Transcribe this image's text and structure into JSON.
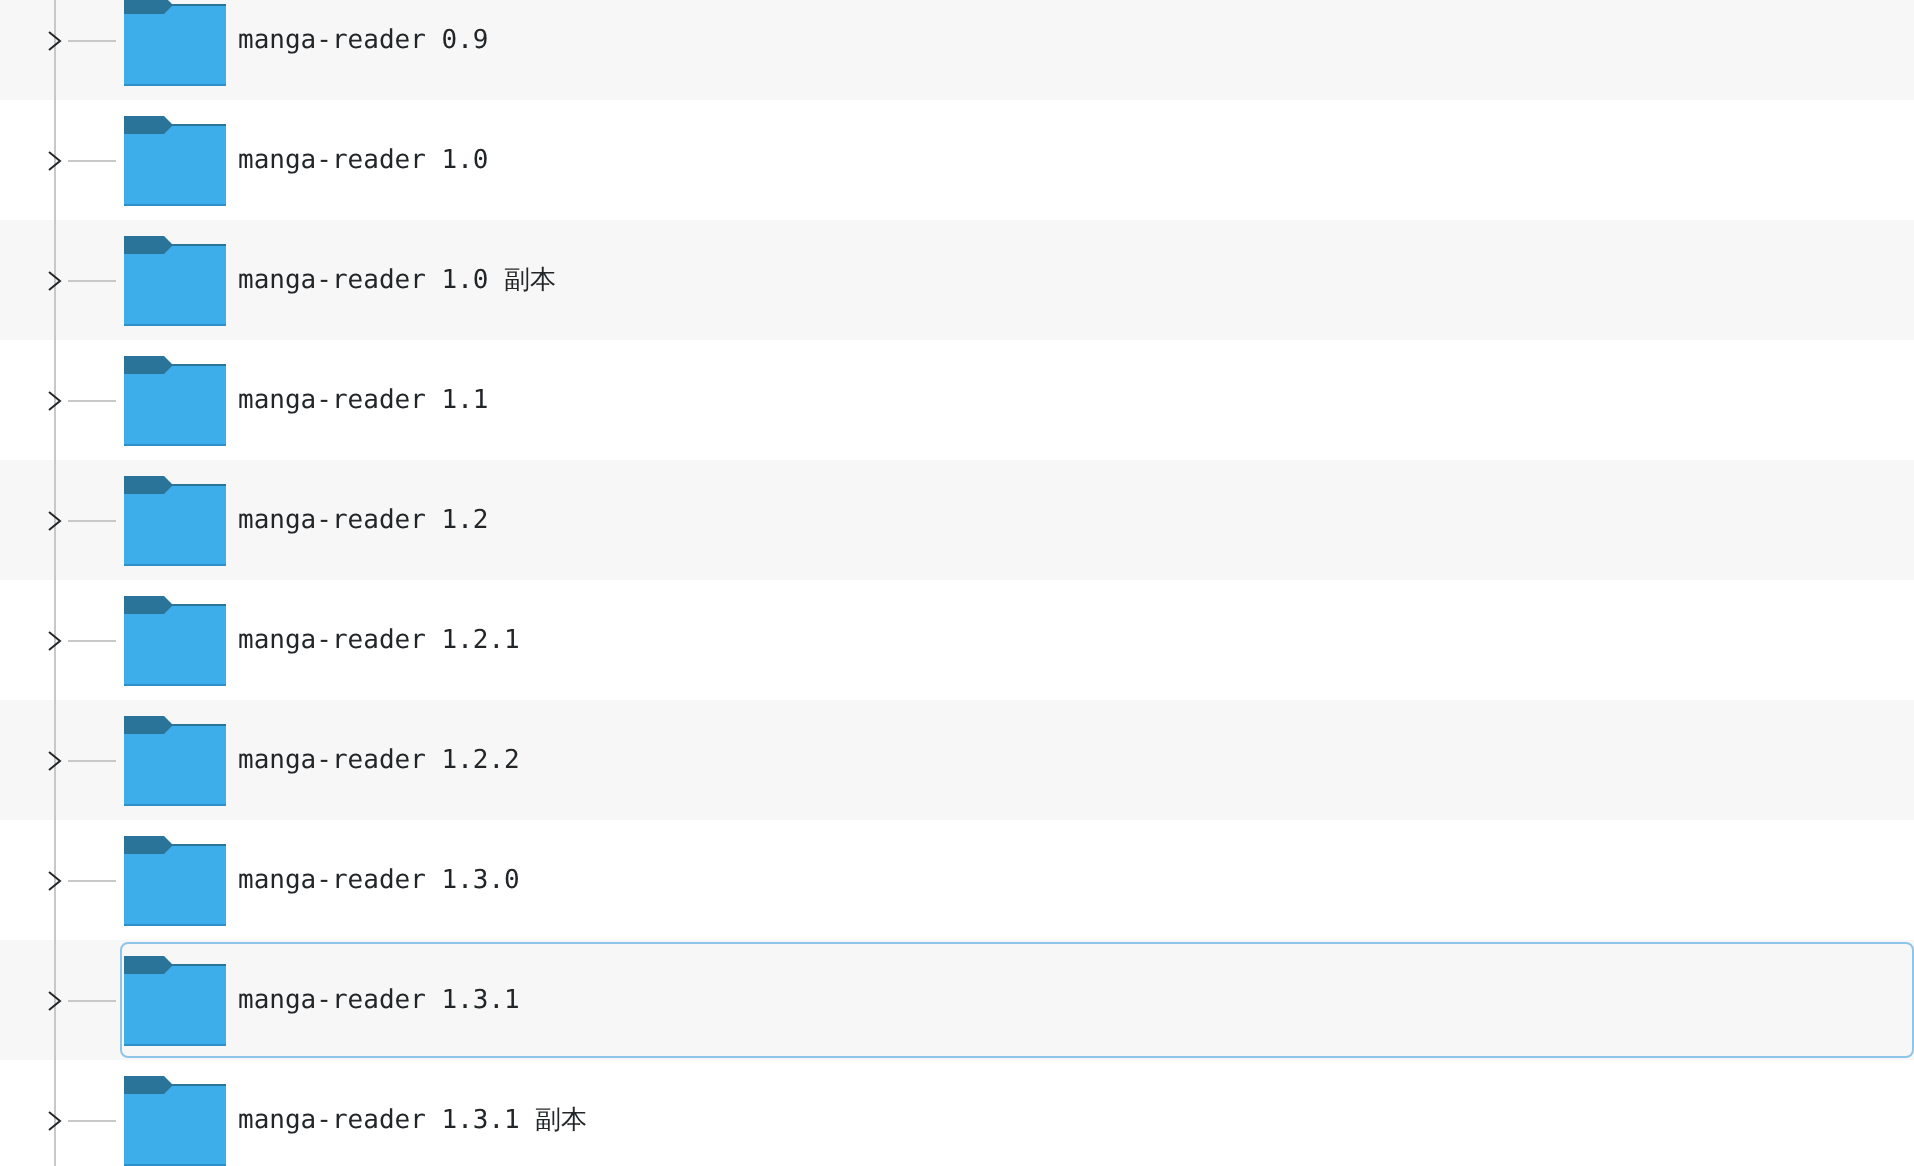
{
  "folders": [
    {
      "name": "manga-reader 0.9",
      "expanded": false,
      "selected": false
    },
    {
      "name": "manga-reader 1.0",
      "expanded": false,
      "selected": false
    },
    {
      "name": "manga-reader 1.0 副本",
      "expanded": false,
      "selected": false
    },
    {
      "name": "manga-reader 1.1",
      "expanded": false,
      "selected": false
    },
    {
      "name": "manga-reader 1.2",
      "expanded": false,
      "selected": false
    },
    {
      "name": "manga-reader 1.2.1",
      "expanded": false,
      "selected": false
    },
    {
      "name": "manga-reader 1.2.2",
      "expanded": false,
      "selected": false
    },
    {
      "name": "manga-reader 1.3.0",
      "expanded": false,
      "selected": false
    },
    {
      "name": "manga-reader 1.3.1",
      "expanded": false,
      "selected": true
    },
    {
      "name": "manga-reader 1.3.1 副本",
      "expanded": false,
      "selected": false
    }
  ]
}
